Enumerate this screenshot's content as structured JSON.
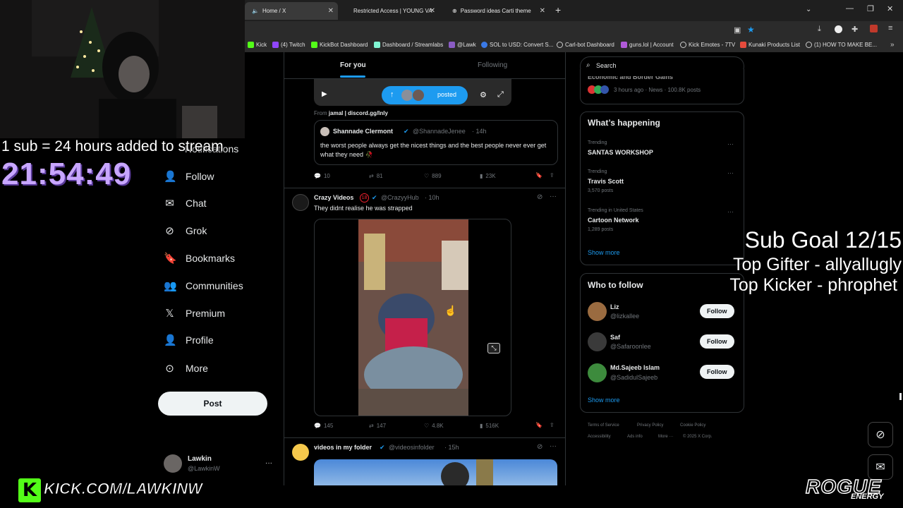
{
  "browser": {
    "tabs": [
      {
        "label": "Home / X",
        "active": true
      },
      {
        "label": "Restricted Access | YOUNG VAM",
        "active": false
      },
      {
        "label": "Password ideas Carti theme",
        "active": false
      }
    ],
    "new_tab": "+",
    "bookmarks": [
      "Kick",
      "(4) Twitch",
      "KickBot Dashboard",
      "Dashboard / Streamlabs",
      "@Lawk",
      "SOL to USD: Convert S...",
      "Carl-bot Dashboard",
      "guns.lol | Account",
      "Kick Emotes - 7TV",
      "Kunaki Products List",
      "(1) HOW TO MAKE BE..."
    ]
  },
  "stream_overlay": {
    "sub_rule": "1 sub = 24 hours added to stream",
    "timer": "21:54:49",
    "sub_goal": "Sub Goal 12/15",
    "top_gifter": "Top Gifter - allyallugly",
    "top_kicker": "Top Kicker - phrophet",
    "kick_url": "KICK.COM/LAWKINW",
    "sponsor": "ROGUE",
    "sponsor_sub": "ENERGY"
  },
  "sidebar": {
    "partial_item": "Notifications",
    "items": [
      {
        "label": "Follow",
        "icon": "person-plus-icon"
      },
      {
        "label": "Chat",
        "icon": "envelope-icon"
      },
      {
        "label": "Grok",
        "icon": "grok-icon"
      },
      {
        "label": "Bookmarks",
        "icon": "bookmark-icon"
      },
      {
        "label": "Communities",
        "icon": "people-icon"
      },
      {
        "label": "Premium",
        "icon": "x-logo-icon"
      },
      {
        "label": "Profile",
        "icon": "person-icon"
      },
      {
        "label": "More",
        "icon": "more-circle-icon"
      }
    ],
    "post_button": "Post",
    "account": {
      "name": "Lawkin",
      "handle": "@LawkinW",
      "more": "···"
    }
  },
  "feed": {
    "tabs": [
      "For you",
      "Following"
    ],
    "posted_pill": "posted",
    "post1": {
      "from": "From",
      "from_link": "jamal | discord.gg/lnly",
      "quote_author": "Shannade Clermont",
      "quote_handle": "@ShannadeJenee",
      "quote_time": "· 14h",
      "quote_text": "the worst people always get the nicest things and the best people never ever get what they need 🥀",
      "replies": "10",
      "reposts": "81",
      "likes": "889",
      "views": "23K"
    },
    "post2": {
      "author": "Crazy Videos",
      "badge": "18",
      "handle": "@CrazyyHub",
      "time": "· 10h",
      "text": "They didnt realise he was strapped",
      "replies": "145",
      "reposts": "147",
      "likes": "4.8K",
      "views": "516K"
    },
    "post3": {
      "author": "videos in my folder",
      "handle": "@videosinfolder",
      "time": "· 15h"
    }
  },
  "right": {
    "search_placeholder": "Search",
    "top_partial": "Economic and Border Gains",
    "top_meta": "3 hours ago · News · 100.8K posts",
    "happening_title": "What’s happening",
    "trends": [
      {
        "context": "Trending",
        "name": "SANTAS WORKSHOP",
        "count": ""
      },
      {
        "context": "Trending",
        "name": "Travis Scott",
        "count": "3,570 posts"
      },
      {
        "context": "Trending in United States",
        "name": "Cartoon Network",
        "count": "1,289 posts"
      }
    ],
    "show_more": "Show more",
    "who_title": "Who to follow",
    "who": [
      {
        "name": "Liz",
        "handle": "@lizkallee",
        "btn": "Follow"
      },
      {
        "name": "Saf",
        "handle": "@Safaroonlee",
        "btn": "Follow"
      },
      {
        "name": "Md.Sajeeb Islam",
        "handle": "@SadidulSajeeb",
        "btn": "Follow"
      }
    ],
    "who_show_more": "Show more",
    "footer": [
      "Terms of Service",
      "Privacy Policy",
      "Cookie Policy",
      "Accessibility",
      "Ads info",
      "More ···",
      "© 2025 X Corp."
    ]
  },
  "colors": {
    "accent": "#1d9bf0",
    "kick_green": "#53fc18",
    "timer_purple": "#c8a6ff"
  }
}
